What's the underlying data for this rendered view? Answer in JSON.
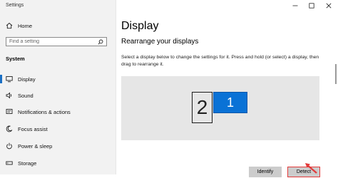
{
  "window": {
    "title": "Settings"
  },
  "sidebar": {
    "home_label": "Home",
    "search_placeholder": "Find a setting",
    "section_label": "System",
    "items": [
      {
        "label": "Display",
        "icon": "monitor-icon",
        "selected": true
      },
      {
        "label": "Sound",
        "icon": "speaker-icon"
      },
      {
        "label": "Notifications & actions",
        "icon": "notifications-icon"
      },
      {
        "label": "Focus assist",
        "icon": "moon-icon"
      },
      {
        "label": "Power & sleep",
        "icon": "power-icon"
      },
      {
        "label": "Storage",
        "icon": "storage-icon"
      }
    ]
  },
  "main": {
    "title": "Display",
    "subheading": "Rearrange your displays",
    "description": "Select a display below to change the settings for it. Press and hold (or select) a display, then drag to rearrange it.",
    "displays": [
      {
        "number": "2",
        "selected": false
      },
      {
        "number": "1",
        "selected": true
      }
    ],
    "identify_label": "Identify",
    "detect_label": "Detect"
  },
  "colors": {
    "accent": "#0a72d6",
    "highlight": "#e23a3a",
    "sidebar_bg": "#f2f2f2",
    "arrange_bg": "#e6e6e6"
  }
}
